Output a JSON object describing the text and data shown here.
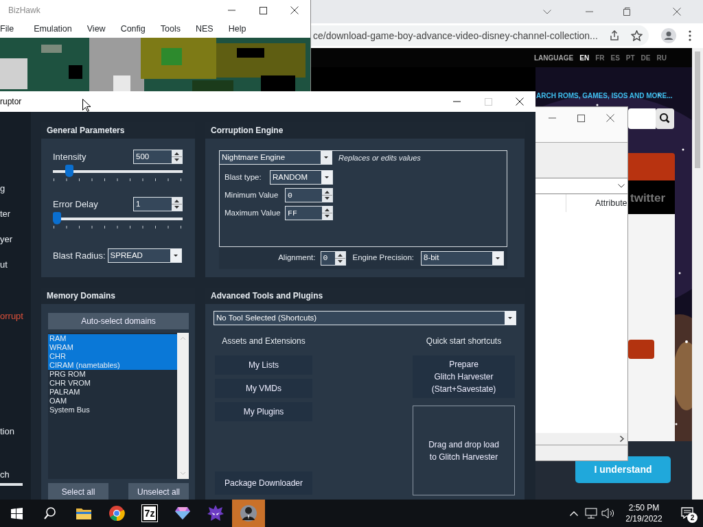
{
  "browser": {
    "url": "ce/download-game-boy-advance-video-disney-channel-collection...",
    "language_label": "LANGUAGE",
    "languages": [
      {
        "code": "EN",
        "selected": true
      },
      {
        "code": "FR",
        "selected": false
      },
      {
        "code": "ES",
        "selected": false
      },
      {
        "code": "PT",
        "selected": false
      },
      {
        "code": "DE",
        "selected": false
      },
      {
        "code": "RU",
        "selected": false
      }
    ],
    "search_banner": "ARCH ROMS, GAMES, ISOS AND MORE...",
    "social_label": "twitter",
    "accept_button": "I understand"
  },
  "bizhawk": {
    "title": "BizHawk",
    "menu": [
      "File",
      "Emulation",
      "View",
      "Config",
      "Tools",
      "NES",
      "Help"
    ]
  },
  "side_window": {
    "column_header": "Attribute"
  },
  "corruptor": {
    "title": "ruptor",
    "sidebar": [
      {
        "label": "g",
        "selected": false
      },
      {
        "label": "ter",
        "selected": false
      },
      {
        "label": "yer",
        "selected": false
      },
      {
        "label": "ut",
        "selected": false
      },
      {
        "label": "orrupt",
        "selected": true
      },
      {
        "label": "tion",
        "selected": false
      },
      {
        "label": "ch",
        "selected": false
      }
    ],
    "general": {
      "title": "General Parameters",
      "sliders": [
        {
          "label": "Intensity",
          "value": "500",
          "level": 0.1
        },
        {
          "label": "Error Delay",
          "value": "1",
          "level": 0.0
        }
      ],
      "blast_radius": {
        "label": "Blast Radius:",
        "value": "SPREAD"
      }
    },
    "engine": {
      "title": "Corruption Engine",
      "engine": "Nightmare Engine",
      "description": "Replaces or edits values",
      "fields": [
        {
          "kind": "dropdown",
          "label": "Blast type:",
          "value": "RANDOM"
        },
        {
          "kind": "spinner",
          "label": "Minimum Value",
          "value": "0"
        },
        {
          "kind": "spinner",
          "label": "Maximum Value",
          "value": "FF"
        }
      ],
      "alignment": {
        "label": "Alignment:",
        "value": "0"
      },
      "precision": {
        "label": "Engine Precision:",
        "value": "8-bit"
      }
    },
    "memory": {
      "title": "Memory Domains",
      "auto_button": "Auto-select domains",
      "domains": [
        {
          "name": "RAM",
          "selected": true
        },
        {
          "name": "WRAM",
          "selected": true
        },
        {
          "name": "CHR",
          "selected": true
        },
        {
          "name": "CIRAM (nametables)",
          "selected": true
        },
        {
          "name": "PRG ROM",
          "selected": false
        },
        {
          "name": "CHR VROM",
          "selected": false
        },
        {
          "name": "PALRAM",
          "selected": false
        },
        {
          "name": "OAM",
          "selected": false
        },
        {
          "name": "System Bus",
          "selected": false
        }
      ],
      "select_all": "Select all",
      "unselect_all": "Unselect all"
    },
    "tools": {
      "title": "Advanced Tools and Plugins",
      "tool_select": "No Tool Selected (Shortcuts)",
      "assets_title": "Assets and Extensions",
      "assets": [
        "My Lists",
        "My VMDs",
        "My Plugins"
      ],
      "package_button": "Package Downloader",
      "quick_title": "Quick start shortcuts",
      "prepare_button": "Prepare\nGlitch Harvester\n(Start+Savestate)",
      "drop_zone": "Drag and drop load\nto Glitch Harvester"
    }
  },
  "taskbar": {
    "apps": [
      {
        "kind": "folder",
        "selected": false
      },
      {
        "kind": "browser",
        "selected": false
      },
      {
        "kind": "archiver",
        "label": "7z",
        "selected": false
      },
      {
        "kind": "gem",
        "selected": false
      },
      {
        "kind": "mask",
        "selected": false
      },
      {
        "kind": "figure",
        "selected": true
      }
    ],
    "time": "2:50 PM",
    "date": "2/19/2022",
    "notifications": "2"
  }
}
